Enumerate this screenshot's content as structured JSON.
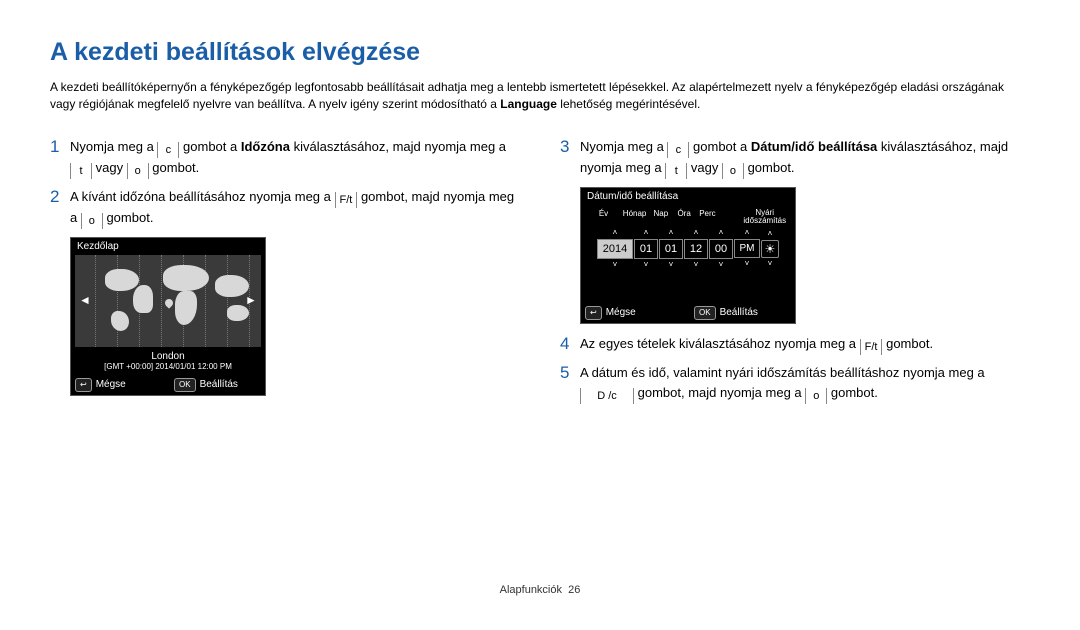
{
  "title": "A kezdeti beállítások elvégzése",
  "intro_plain_1": "A kezdeti beállítóképernyőn a fényképezőgép legfontosabb beállításait adhatja meg a lentebb ismertetett lépésekkel. Az alapértelmezett nyelv a fényképezőgép eladási országának vagy régiójának megfelelő nyelvre van beállítva. A nyelv igény szerint módosítható a ",
  "intro_bold": "Language",
  "intro_plain_2": " lehetőség megérintésével.",
  "steps": {
    "s1": {
      "num": "1",
      "a": "Nyomja meg a ",
      "g1": "c",
      "b": " gombot a ",
      "bold": "Időzóna",
      "c": " kiválasztásához, majd nyomja meg a ",
      "g2": "t",
      "d": " vagy ",
      "g3": "o",
      "e": " gombot."
    },
    "s2": {
      "num": "2",
      "a": "A kívánt időzóna beállításához nyomja meg a ",
      "g1": "F/t",
      "b": " gombot, majd nyomja meg a ",
      "g2": "o",
      "c": " gombot."
    },
    "s3": {
      "num": "3",
      "a": "Nyomja meg a ",
      "g1": "c",
      "b": " gombot a ",
      "bold": "Dátum/idő beállítása",
      "c": " kiválasztásához, majd nyomja meg a ",
      "g2": "t",
      "d": " vagy ",
      "g3": "o",
      "e": " gombot."
    },
    "s4": {
      "num": "4",
      "a": "Az egyes tételek kiválasztásához nyomja meg a ",
      "g1": "F/t",
      "b": " gombot."
    },
    "s5": {
      "num": "5",
      "a": "A dátum és idő, valamint nyári időszámítás beállításhoz nyomja meg a ",
      "g1": "D      /c",
      "b": " gombot, majd nyomja meg a ",
      "g2": "o",
      "c": " gombot."
    }
  },
  "tz_screen": {
    "header": "Kezdőlap",
    "city": "London",
    "gmt": "[GMT +00:00] 2014/01/01 12:00 PM",
    "back_glyph": "↩",
    "cancel": "Mégse",
    "ok_glyph": "OK",
    "set": "Beállítás"
  },
  "dt_screen": {
    "header": "Dátum/idő beállítása",
    "labels": {
      "year": "Év",
      "month": "Hónap",
      "day": "Nap",
      "hour": "Óra",
      "min": "Perc",
      "dst": "Nyári\nidőszámítás"
    },
    "values": {
      "year": "2014",
      "month": "01",
      "day": "01",
      "hour": "12",
      "min": "00",
      "ampm": "PM"
    },
    "dst_icon": "☀",
    "back_glyph": "↩",
    "cancel": "Mégse",
    "ok_glyph": "OK",
    "set": "Beállítás"
  },
  "footer": {
    "section": "Alapfunkciók",
    "page": "26"
  }
}
